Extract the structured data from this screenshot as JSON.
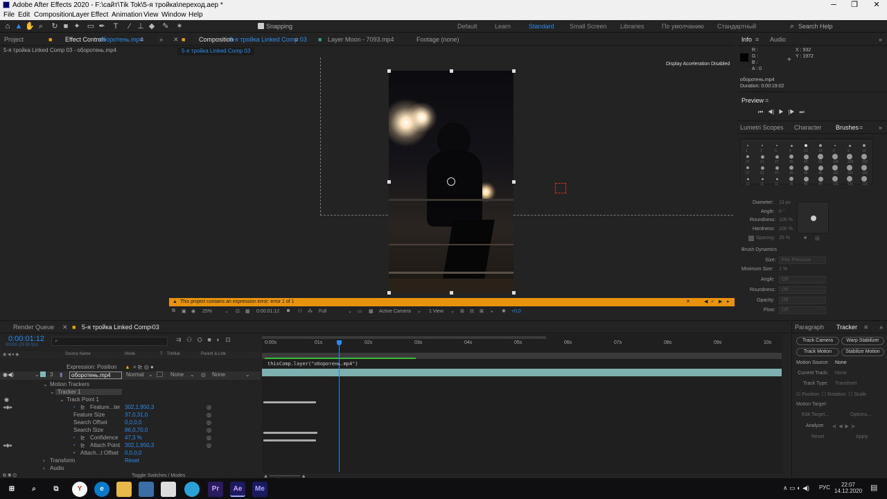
{
  "window": {
    "title": "Adobe After Effects 2020 - F:\\сайт\\Tik Tok\\5-я тройка\\переход.аер *",
    "minimize": "─",
    "maximize": "❐",
    "close": "✕"
  },
  "menu": [
    "File",
    "Edit",
    "Composition",
    "Layer",
    "Effect",
    "Animation",
    "View",
    "Window",
    "Help"
  ],
  "toolbar": {
    "snapping": "Snapping",
    "workspaces": [
      "Default",
      "Learn",
      "Standard",
      "Small Screen",
      "Libraries",
      "По умолчанию",
      "Стандартный"
    ],
    "search_placeholder": "Search Help"
  },
  "left_panel": {
    "tab_project": "Project",
    "tab_effect_controls": "Effect Controls",
    "effect_target": "оборотень.mp4",
    "subtitle": "5-я тройка Linked Comp 03 - оборотень.mp4"
  },
  "comp_panel": {
    "tab_composition": "Composition",
    "comp_name": "5-я тройка Linked Comp 03",
    "tab_layer": "Layer Moon - 7093.mp4",
    "tab_footage": "Footage (none)",
    "breadcrumb": "5-я тройка Linked Comp 03",
    "acceleration": "Display Acceleration Disabled",
    "error": "This project contains an expression error: error 1 of 1",
    "zoom": "25%",
    "timecode": "0:00:01:12",
    "resolution": "Full",
    "camera": "Active Camera",
    "view": "1 View",
    "exposure": "+0,0"
  },
  "info_panel": {
    "tab_info": "Info",
    "tab_audio": "Audio",
    "r": "R :",
    "g": "G :",
    "b": "B :",
    "a": "A : 0",
    "x": "X : 932",
    "y": "Y : 1972",
    "file": "оборотень.mp4",
    "duration": "Duration: 0:00:19:02"
  },
  "preview": {
    "title": "Preview"
  },
  "brushes_panel": {
    "tab_lumetri": "Lumetri Scopes",
    "tab_character": "Character",
    "tab_brushes": "Brushes",
    "sizes": [
      "1",
      "3",
      "5",
      "9",
      "13",
      "19",
      "5",
      "9",
      "13",
      "17",
      "21",
      "27",
      "35",
      "45",
      "65",
      "100",
      "200",
      "300",
      "17",
      "21",
      "27",
      "35",
      "45",
      "45",
      "131",
      "131",
      "131",
      "12",
      "11",
      "11",
      "35",
      "45",
      "45",
      "131",
      "131",
      "131"
    ],
    "diameter": "Diameter:",
    "diameter_val": "13 px",
    "angle": "Angle:",
    "angle_val": "0 °",
    "roundness": "Roundness:",
    "roundness_val": "100 %",
    "hardness": "Hardness:",
    "hardness_val": "100 %",
    "spacing": "Spacing:",
    "spacing_val": "25 %",
    "dynamics": "Brush Dynamics",
    "size": "Size:",
    "size_val": "Pen Pressure",
    "min_size": "Minimum Size:",
    "min_size_val": "1 %",
    "dyn_angle": "Angle:",
    "off": "Off",
    "dyn_roundness": "Roundness:",
    "opacity": "Opacity:",
    "flow": "Flow:"
  },
  "timeline": {
    "tab_render": "Render Queue",
    "tab_comp": "5-я тройка Linked Comp 03",
    "timecode": "0:00:01:12",
    "fps": "00036 (25.00 fps)",
    "col_source": "Source Name",
    "col_mode": "Mode",
    "col_t": "T",
    "col_trkmat": "TrkMat",
    "col_parent": "Parent & Link",
    "expr_label": "Expression: Position",
    "expression": "thisComp.layer(\"оборотень.mp4\")",
    "layer_num": "3",
    "layer_name": "оборотень.mp4",
    "layer_mode": "Normal",
    "layer_trkmat": "None",
    "layer_parent": "None",
    "motion_trackers": "Motion Trackers",
    "tracker1": "Tracker 1",
    "track_point": "Track Point 1",
    "props": [
      {
        "name": "Feature...ter",
        "value": "302,1,950,3"
      },
      {
        "name": "Feature Size",
        "value": "37,0,31,0"
      },
      {
        "name": "Search Offset",
        "value": "0,0,0,0"
      },
      {
        "name": "Search Size",
        "value": "86,0,70,0"
      },
      {
        "name": "Confidence",
        "value": "47,3 %"
      },
      {
        "name": "Attach Point",
        "value": "302,1,950,3"
      },
      {
        "name": "Attach...t Offset",
        "value": "0,0,0,0"
      }
    ],
    "transform": "Transform",
    "transform_val": "Reset",
    "audio": "Audio",
    "toggle": "Toggle Switches / Modes",
    "ruler": [
      "0:00s",
      "01s",
      "02s",
      "03s",
      "04s",
      "05s",
      "06s",
      "07s",
      "08s",
      "09s",
      "10s"
    ]
  },
  "tracker_panel": {
    "tab_paragraph": "Paragraph",
    "tab_tracker": "Tracker",
    "track_camera": "Track Camera",
    "warp_stabilizer": "Warp Stabilizer",
    "track_motion": "Track Motion",
    "stabilize_motion": "Stabilize Motion",
    "motion_source": "Motion Source:",
    "motion_source_val": "None",
    "current_track": "Current Track:",
    "current_track_val": "None",
    "track_type": "Track Type:",
    "track_type_val": "Transform",
    "position": "Position",
    "rotation": "Rotation",
    "scale": "Scale",
    "motion_target": "Motion Target:",
    "edit_target": "Edit Target...",
    "options": "Options...",
    "analyze": "Analyze:",
    "reset": "Reset",
    "apply": "Apply"
  },
  "taskbar": {
    "lang": "РУС",
    "time": "22:07",
    "date": "14.12.2020",
    "apps": [
      "Y",
      "e",
      "Pr",
      "Ae",
      "Me"
    ]
  },
  "colors": {
    "accent": "#2d8ceb",
    "warning": "#e8a30d",
    "bg": "#232323"
  }
}
